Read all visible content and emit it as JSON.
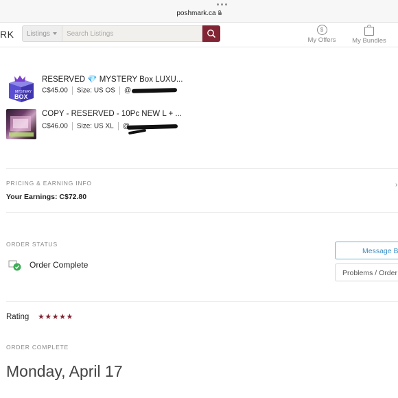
{
  "browser": {
    "domain": "poshmark.ca"
  },
  "header": {
    "logo_fragment": "RK",
    "search_category": "Listings",
    "search_placeholder": "Search Listings",
    "nav": {
      "offers_label": "My Offers",
      "bundles_label": "My Bundles"
    }
  },
  "items": [
    {
      "title": "RESERVED 💎 MYSTERY Box LUXU...",
      "price": "C$45.00",
      "size": "Size: US OS",
      "username": "@"
    },
    {
      "title": "COPY - RESERVED - 10Pc NEW L + ...",
      "price": "C$46.00",
      "size": "Size: US XL",
      "username": "@"
    }
  ],
  "thumb1": {
    "line1": "MYSTERY",
    "line2": "BOX"
  },
  "pricing": {
    "label": "PRICING & EARNING INFO",
    "earnings": "Your Earnings: C$72.80"
  },
  "order_status": {
    "label": "ORDER STATUS",
    "status": "Order Complete",
    "message_button": "Message B",
    "problems_button": "Problems / Order"
  },
  "rating": {
    "label": "Rating",
    "stars": "★★★★★",
    "value": 5,
    "max": 5
  },
  "order_complete": {
    "label": "ORDER COMPLETE",
    "date": "Monday, April 17"
  },
  "colors": {
    "brand": "#822433",
    "accent_blue": "#3d8fc4"
  },
  "icons": [
    "lock-icon",
    "search-icon",
    "offer-dollar-icon",
    "bag-icon",
    "order-complete-check-icon"
  ]
}
